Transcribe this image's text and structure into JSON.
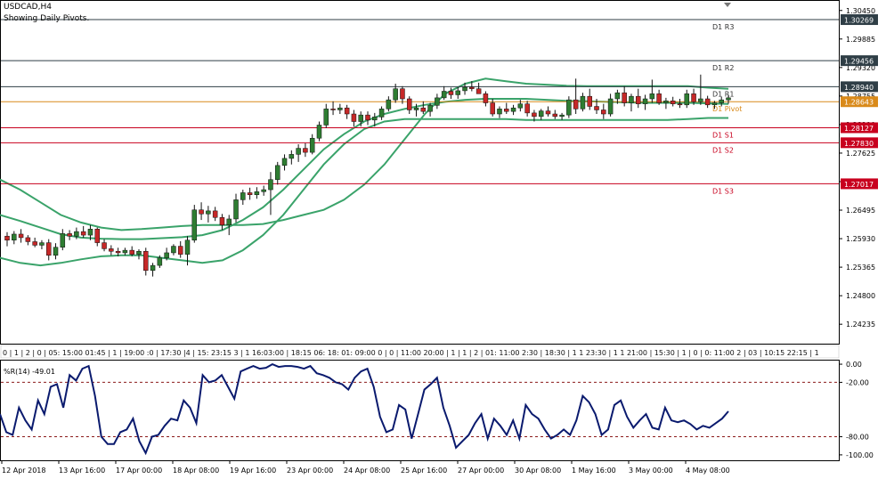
{
  "header": {
    "symbol": "USDCAD,H4",
    "subtitle": "Showing Daily Pivots."
  },
  "colors": {
    "bull": "#2e7d32",
    "bear": "#c62828",
    "bands": "#3aa36a",
    "pivot": "#d98a1a",
    "resist": "#2f3e46",
    "support": "#c8001e",
    "wpr": "#0a1a6e",
    "label_bg": "#c8001e"
  },
  "chart_data": [
    {
      "type": "candlestick",
      "ylim": [
        1.2385,
        1.3064
      ],
      "y_ticks": [
        "1.30450",
        "1.29885",
        "1.29320",
        "1.28755",
        "1.28190",
        "1.27625",
        "1.27060",
        "1.26495",
        "1.25930",
        "1.25365",
        "1.24800",
        "1.24235"
      ],
      "y_tick_values": [
        1.3045,
        1.29885,
        1.2932,
        1.28755,
        1.2819,
        1.27625,
        1.2706,
        1.26495,
        1.2593,
        1.25365,
        1.248,
        1.24235
      ],
      "levels": [
        {
          "name": "D1 R3",
          "value": 1.30269,
          "label": "1.30269",
          "kind": "resist"
        },
        {
          "name": "D1 R2",
          "value": 1.29456,
          "label": "1.29456",
          "kind": "resist"
        },
        {
          "name": "D1 R1",
          "value": 1.2894,
          "label": "1.28940",
          "kind": "resist"
        },
        {
          "name": "D1 Pivot",
          "value": 1.28643,
          "label": "1.28643",
          "kind": "pivot"
        },
        {
          "name": "D1 S1",
          "value": 1.28127,
          "label": "1.28127",
          "kind": "support"
        },
        {
          "name": "D1 S2",
          "value": 1.2783,
          "label": "1.27830",
          "kind": "support"
        },
        {
          "name": "D1 S3",
          "value": 1.27017,
          "label": "1.27017",
          "kind": "support"
        }
      ],
      "candles": [
        [
          1.2598,
          1.2606,
          1.2578,
          1.259
        ],
        [
          1.259,
          1.2608,
          1.2582,
          1.2602
        ],
        [
          1.2602,
          1.2612,
          1.2585,
          1.2595
        ],
        [
          1.2595,
          1.26,
          1.258,
          1.2587
        ],
        [
          1.2587,
          1.2595,
          1.2576,
          1.258
        ],
        [
          1.258,
          1.259,
          1.2572,
          1.2585
        ],
        [
          1.2585,
          1.2592,
          1.255,
          1.256
        ],
        [
          1.256,
          1.2584,
          1.2552,
          1.2576
        ],
        [
          1.2576,
          1.2612,
          1.257,
          1.2603
        ],
        [
          1.2603,
          1.261,
          1.259,
          1.2598
        ],
        [
          1.2598,
          1.2615,
          1.2592,
          1.2607
        ],
        [
          1.2607,
          1.2618,
          1.2595,
          1.26
        ],
        [
          1.26,
          1.262,
          1.259,
          1.2612
        ],
        [
          1.2612,
          1.2615,
          1.2578,
          1.2585
        ],
        [
          1.2585,
          1.2592,
          1.2568,
          1.2573
        ],
        [
          1.2573,
          1.258,
          1.256,
          1.2568
        ],
        [
          1.2568,
          1.2575,
          1.2558,
          1.2565
        ],
        [
          1.2565,
          1.2575,
          1.256,
          1.257
        ],
        [
          1.257,
          1.2578,
          1.2558,
          1.2562
        ],
        [
          1.2562,
          1.2572,
          1.2552,
          1.2568
        ],
        [
          1.2568,
          1.2575,
          1.252,
          1.253
        ],
        [
          1.253,
          1.2545,
          1.2518,
          1.254
        ],
        [
          1.254,
          1.256,
          1.2535,
          1.2555
        ],
        [
          1.2555,
          1.2575,
          1.255,
          1.2565
        ],
        [
          1.2565,
          1.2582,
          1.256,
          1.2578
        ],
        [
          1.2578,
          1.2588,
          1.2555,
          1.2562
        ],
        [
          1.2562,
          1.2598,
          1.254,
          1.259
        ],
        [
          1.259,
          1.266,
          1.2585,
          1.265
        ],
        [
          1.265,
          1.2665,
          1.263,
          1.2642
        ],
        [
          1.2642,
          1.2658,
          1.2625,
          1.2648
        ],
        [
          1.2648,
          1.2656,
          1.2628,
          1.2635
        ],
        [
          1.2635,
          1.2642,
          1.261,
          1.262
        ],
        [
          1.262,
          1.264,
          1.26,
          1.2632
        ],
        [
          1.2632,
          1.2682,
          1.2625,
          1.267
        ],
        [
          1.267,
          1.269,
          1.266,
          1.2684
        ],
        [
          1.2684,
          1.2694,
          1.267,
          1.268
        ],
        [
          1.268,
          1.2695,
          1.2672,
          1.2686
        ],
        [
          1.2686,
          1.2698,
          1.2678,
          1.269
        ],
        [
          1.269,
          1.2725,
          1.264,
          1.271
        ],
        [
          1.271,
          1.2745,
          1.27,
          1.2738
        ],
        [
          1.2738,
          1.276,
          1.2728,
          1.2752
        ],
        [
          1.2752,
          1.2768,
          1.274,
          1.276
        ],
        [
          1.276,
          1.278,
          1.2745,
          1.2772
        ],
        [
          1.2772,
          1.2782,
          1.2755,
          1.2764
        ],
        [
          1.2764,
          1.28,
          1.276,
          1.2792
        ],
        [
          1.2792,
          1.2825,
          1.2786,
          1.2818
        ],
        [
          1.2818,
          1.286,
          1.2812,
          1.285
        ],
        [
          1.285,
          1.2865,
          1.2838,
          1.2848
        ],
        [
          1.2848,
          1.286,
          1.284,
          1.2852
        ],
        [
          1.2852,
          1.2858,
          1.283,
          1.284
        ],
        [
          1.284,
          1.2848,
          1.2815,
          1.2825
        ],
        [
          1.2825,
          1.2845,
          1.2815,
          1.2838
        ],
        [
          1.2838,
          1.2845,
          1.2818,
          1.2828
        ],
        [
          1.2828,
          1.2842,
          1.2815,
          1.2834
        ],
        [
          1.2834,
          1.2855,
          1.2828,
          1.285
        ],
        [
          1.285,
          1.2875,
          1.2845,
          1.2868
        ],
        [
          1.2868,
          1.29,
          1.2862,
          1.289
        ],
        [
          1.289,
          1.2895,
          1.286,
          1.287
        ],
        [
          1.287,
          1.2875,
          1.284,
          1.2848
        ],
        [
          1.2848,
          1.286,
          1.2835,
          1.2852
        ],
        [
          1.2852,
          1.2865,
          1.284,
          1.2845
        ],
        [
          1.2845,
          1.2862,
          1.2835,
          1.2857
        ],
        [
          1.2857,
          1.288,
          1.285,
          1.2872
        ],
        [
          1.2872,
          1.2895,
          1.2868,
          1.2885
        ],
        [
          1.2885,
          1.2892,
          1.287,
          1.2878
        ],
        [
          1.2878,
          1.2893,
          1.287,
          1.2886
        ],
        [
          1.2886,
          1.2902,
          1.2878,
          1.2893
        ],
        [
          1.2893,
          1.2905,
          1.2885,
          1.289
        ],
        [
          1.289,
          1.2902,
          1.288,
          1.288
        ],
        [
          1.288,
          1.2885,
          1.2855,
          1.2862
        ],
        [
          1.2862,
          1.287,
          1.2835,
          1.284
        ],
        [
          1.284,
          1.2855,
          1.2832,
          1.285
        ],
        [
          1.285,
          1.2862,
          1.284,
          1.2845
        ],
        [
          1.2845,
          1.2858,
          1.2838,
          1.2852
        ],
        [
          1.2852,
          1.2868,
          1.2845,
          1.286
        ],
        [
          1.286,
          1.2866,
          1.2835,
          1.2842
        ],
        [
          1.2842,
          1.2848,
          1.2825,
          1.2835
        ],
        [
          1.2835,
          1.285,
          1.2828,
          1.2846
        ],
        [
          1.2846,
          1.2855,
          1.2835,
          1.284
        ],
        [
          1.284,
          1.2848,
          1.283,
          1.2835
        ],
        [
          1.2835,
          1.2842,
          1.2828,
          1.2838
        ],
        [
          1.2838,
          1.2875,
          1.2832,
          1.2868
        ],
        [
          1.2868,
          1.291,
          1.284,
          1.285
        ],
        [
          1.285,
          1.2882,
          1.2845,
          1.2875
        ],
        [
          1.2875,
          1.289,
          1.2848,
          1.2855
        ],
        [
          1.2855,
          1.287,
          1.284,
          1.2848
        ],
        [
          1.2848,
          1.286,
          1.283,
          1.284
        ],
        [
          1.284,
          1.288,
          1.2835,
          1.287
        ],
        [
          1.287,
          1.2888,
          1.286,
          1.2882
        ],
        [
          1.2882,
          1.2895,
          1.2855,
          1.2862
        ],
        [
          1.2862,
          1.288,
          1.2845,
          1.2875
        ],
        [
          1.2875,
          1.289,
          1.2852,
          1.286
        ],
        [
          1.286,
          1.2878,
          1.2848,
          1.287
        ],
        [
          1.287,
          1.2908,
          1.2862,
          1.288
        ],
        [
          1.288,
          1.2888,
          1.2858,
          1.2862
        ],
        [
          1.2862,
          1.2872,
          1.285,
          1.2866
        ],
        [
          1.2866,
          1.2874,
          1.2855,
          1.286
        ],
        [
          1.286,
          1.287,
          1.2852,
          1.2858
        ],
        [
          1.2858,
          1.2888,
          1.2852,
          1.288
        ],
        [
          1.288,
          1.289,
          1.2858,
          1.2864
        ],
        [
          1.2864,
          1.2918,
          1.2858,
          1.287
        ],
        [
          1.287,
          1.2876,
          1.2852,
          1.2858
        ],
        [
          1.2858,
          1.2866,
          1.285,
          1.2862
        ],
        [
          1.2862,
          1.2874,
          1.2855,
          1.2868
        ],
        [
          1.2868,
          1.2878,
          1.286,
          1.2872
        ]
      ],
      "bollinger": {
        "upper": [
          1.271,
          1.269,
          1.2665,
          1.264,
          1.2625,
          1.2615,
          1.261,
          1.2612,
          1.2615,
          1.2618,
          1.262,
          1.262,
          1.262,
          1.2622,
          1.263,
          1.264,
          1.265,
          1.267,
          1.27,
          1.274,
          1.279,
          1.284,
          1.288,
          1.29,
          1.291,
          1.2905,
          1.29,
          1.2898,
          1.2896,
          1.2895,
          1.2895,
          1.2895,
          1.2895,
          1.2895,
          1.2895,
          1.2892,
          1.289
        ],
        "middle": [
          1.264,
          1.2628,
          1.2615,
          1.2602,
          1.2595,
          1.2593,
          1.2592,
          1.2592,
          1.2594,
          1.2596,
          1.26,
          1.261,
          1.263,
          1.2655,
          1.269,
          1.273,
          1.277,
          1.28,
          1.2825,
          1.284,
          1.285,
          1.2858,
          1.2864,
          1.2868,
          1.287,
          1.287,
          1.287,
          1.2868,
          1.2866,
          1.2865,
          1.2864,
          1.2863,
          1.2862,
          1.2862,
          1.2862,
          1.2861,
          1.286
        ],
        "lower": [
          1.2555,
          1.2545,
          1.254,
          1.2545,
          1.2552,
          1.2558,
          1.256,
          1.256,
          1.2555,
          1.255,
          1.2545,
          1.255,
          1.257,
          1.26,
          1.264,
          1.269,
          1.274,
          1.278,
          1.281,
          1.2825,
          1.283,
          1.283,
          1.283,
          1.283,
          1.283,
          1.283,
          1.2828,
          1.2828,
          1.2828,
          1.2828,
          1.2828,
          1.2828,
          1.2828,
          1.2828,
          1.283,
          1.2832,
          1.2832
        ]
      },
      "time_scale_text": "0 | 1 | 2 | 0 | 05: 15:00 01:45 | 1 | 19:00 :0 | 17:30 |4 | 15: 23:15 3 | 1 16:03:00 | 18:15 06: 18: 01: 09:00 0 | 0 | 11:00 20:00 | 1 | 1 | 2 | 01: 11:00 2:30 | 18:30 | 1 1 23:30 | 1 1 21:00 | 15:30 | 1 | 0 | 0: 11:00 2 | 03 | 10:15 22:15 | 1"
    },
    {
      "type": "line",
      "title": "%R(14) -49.01",
      "ylim": [
        -105,
        3
      ],
      "y_ticks": [
        "0.00",
        "-20.00",
        "-80.00",
        "-100.00"
      ],
      "y_tick_values": [
        0,
        -20,
        -80,
        -100
      ],
      "levels": [
        -20,
        -80
      ],
      "values": [
        -55,
        -75,
        -78,
        -48,
        -62,
        -72,
        -40,
        -55,
        -25,
        -22,
        -48,
        -12,
        -18,
        -5,
        -2,
        -35,
        -80,
        -88,
        -88,
        -75,
        -72,
        -60,
        -85,
        -98,
        -80,
        -78,
        -68,
        -60,
        -62,
        -40,
        -48,
        -65,
        -12,
        -20,
        -18,
        -12,
        -25,
        -38,
        -8,
        -5,
        -2,
        -5,
        -4,
        0,
        -3,
        -2,
        -2,
        -3,
        -5,
        -2,
        -10,
        -12,
        -15,
        -20,
        -22,
        -28,
        -15,
        -8,
        -5,
        -25,
        -58,
        -75,
        -72,
        -45,
        -50,
        -82,
        -55,
        -28,
        -22,
        -15,
        -48,
        -68,
        -92,
        -85,
        -78,
        -65,
        -55,
        -82,
        -60,
        -68,
        -78,
        -62,
        -82,
        -45,
        -55,
        -60,
        -72,
        -82,
        -78,
        -72,
        -78,
        -62,
        -35,
        -42,
        -55,
        -78,
        -72,
        -45,
        -40,
        -58,
        -70,
        -62,
        -55,
        -70,
        -72,
        -48,
        -62,
        -64,
        -62,
        -66,
        -72,
        -68,
        -70,
        -65,
        -60,
        -52
      ],
      "x_labels": [
        "12 Apr 2018",
        "13 Apr 16:00",
        "17 Apr 00:00",
        "18 Apr 08:00",
        "19 Apr 16:00",
        "23 Apr 00:00",
        "24 Apr 08:00",
        "25 Apr 16:00",
        "27 Apr 00:00",
        "30 Apr 08:00",
        "1 May 16:00",
        "3 May 00:00",
        "4 May 08:00"
      ]
    }
  ]
}
